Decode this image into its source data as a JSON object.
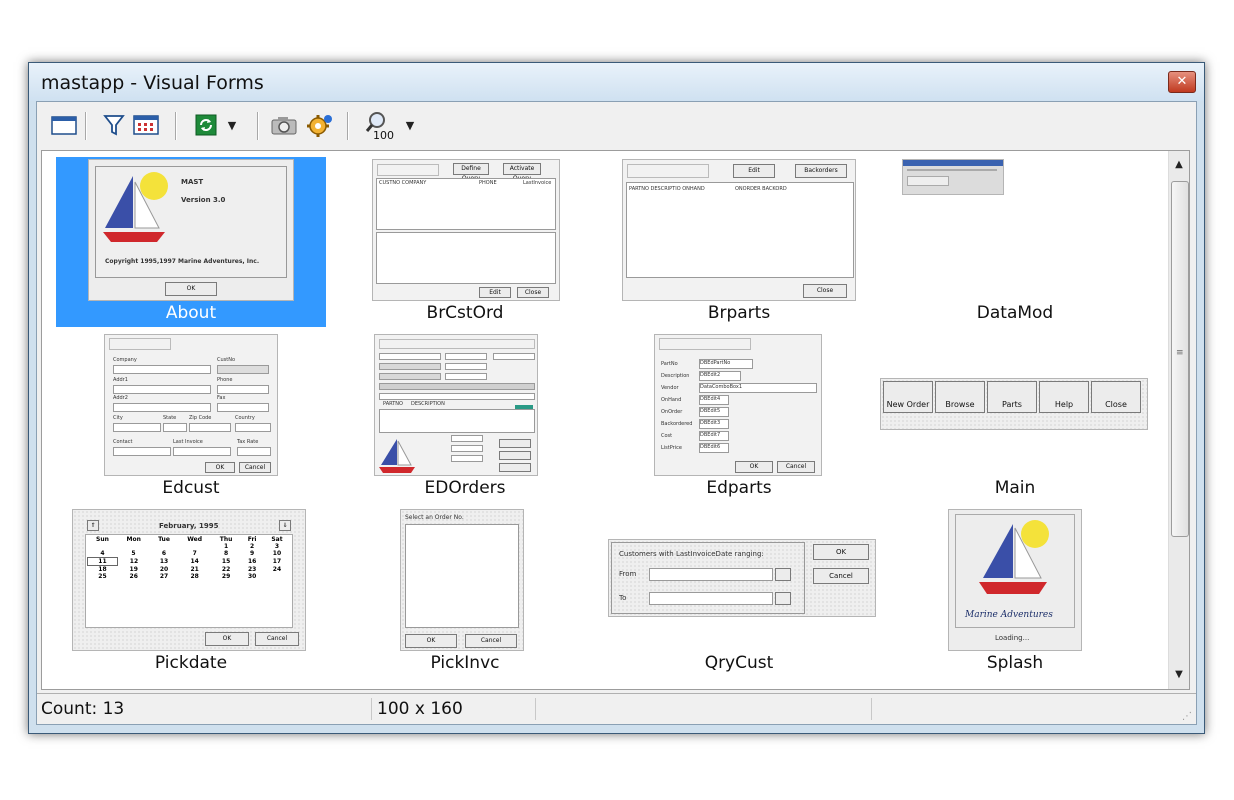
{
  "window": {
    "title": "mastapp - Visual Forms",
    "close_glyph": "✕"
  },
  "toolbar": {
    "buttons": [
      {
        "icon": "form-view-icon"
      },
      {
        "icon": "filter-icon"
      },
      {
        "icon": "grid-icon"
      },
      {
        "icon": "refresh-icon"
      },
      {
        "icon": "camera-icon"
      },
      {
        "icon": "settings-icon"
      },
      {
        "icon": "zoom-icon",
        "label": "100"
      }
    ]
  },
  "forms": [
    {
      "name": "About",
      "selected": true,
      "text": [
        "MAST",
        "Version 3.0",
        "Copyright 1995,1997 Marine Adventures, Inc.",
        "OK"
      ]
    },
    {
      "name": "BrCstOrd",
      "text": [
        "Define Query",
        "Activate Query",
        "CUSTNO COMPANY",
        "PHONE",
        "LastInvoice",
        "Edit",
        "Close"
      ]
    },
    {
      "name": "Brparts",
      "text": [
        "Edit",
        "Backorders",
        "PARTNO DESCRIPTIO ONHAND",
        "ONORDER BACKORD",
        "Close"
      ]
    },
    {
      "name": "DataMod",
      "text": []
    },
    {
      "name": "Edcust",
      "text": [
        "Company",
        "CustNo",
        "Addr1",
        "Phone",
        "Addr2",
        "Fax",
        "City",
        "State",
        "Zip Code",
        "Country",
        "Contact",
        "Last Invoice",
        "Tax Rate",
        "OK",
        "Cancel"
      ]
    },
    {
      "name": "EDOrders",
      "text": [
        "PARTNO",
        "DESCRIPTION"
      ]
    },
    {
      "name": "Edparts",
      "text": [
        "PartNo",
        "Description",
        "Vendor",
        "OnHand",
        "OnOrder",
        "Backordered",
        "Cost",
        "ListPrice",
        "DBEdPartNo",
        "DBEdit2",
        "DataComboBox1",
        "DBEdit4",
        "DBEdit5",
        "DBEdit3",
        "DBEdit7",
        "DBEdit6",
        "OK",
        "Cancel"
      ]
    },
    {
      "name": "Main",
      "text": [
        "New Order",
        "Browse",
        "Parts",
        "Help",
        "Close"
      ]
    },
    {
      "name": "Pickdate",
      "text": [
        "February, 1995",
        "OK",
        "Cancel"
      ],
      "days": [
        "Sun",
        "Mon",
        "Tue",
        "Wed",
        "Thu",
        "Fri",
        "Sat"
      ],
      "weeks": [
        [
          "",
          "",
          "",
          "",
          "1",
          "2",
          "3"
        ],
        [
          "4",
          "5",
          "6",
          "7",
          "8",
          "9",
          "10"
        ],
        [
          "11",
          "12",
          "13",
          "14",
          "15",
          "16",
          "17"
        ],
        [
          "18",
          "19",
          "20",
          "21",
          "22",
          "23",
          "24"
        ],
        [
          "25",
          "26",
          "27",
          "28",
          "29",
          "30",
          ""
        ]
      ]
    },
    {
      "name": "PickInvc",
      "text": [
        "Select an Order No.",
        "OK",
        "Cancel"
      ]
    },
    {
      "name": "QryCust",
      "text": [
        "Customers with LastInvoiceDate ranging:",
        "From",
        "To",
        "OK",
        "Cancel"
      ]
    },
    {
      "name": "Splash",
      "text": [
        "Marine Adventures",
        "Loading..."
      ]
    },
    {
      "name": "",
      "text": []
    }
  ],
  "status": {
    "count": "Count: 13",
    "size": "100 x 160"
  }
}
